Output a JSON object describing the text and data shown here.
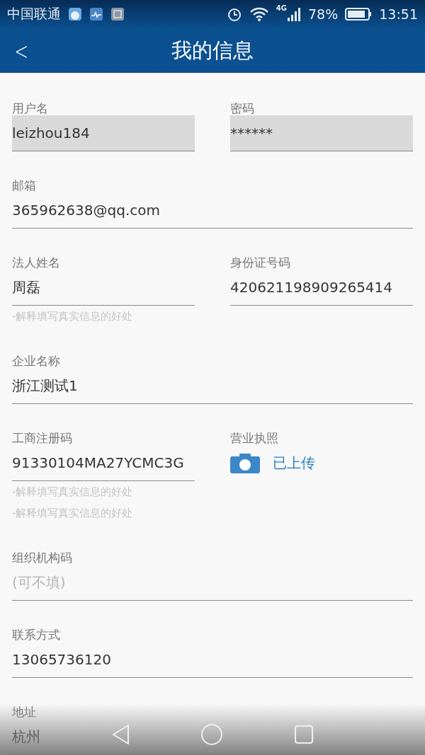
{
  "status_bar": {
    "carrier": "中国联通",
    "network": "4G",
    "battery": "78%",
    "time": "13:51"
  },
  "header": {
    "back": "<",
    "title": "我的信息"
  },
  "rows": [
    {
      "fields": [
        {
          "kind": "text",
          "label": "用户名",
          "value": "leizhou184",
          "disabled": true
        },
        {
          "kind": "text",
          "label": "密码",
          "value": "******",
          "disabled": true
        }
      ]
    },
    {
      "fields": [
        {
          "kind": "text",
          "label": "邮箱",
          "value": "365962638@qq.com",
          "disabled": false
        }
      ]
    },
    {
      "fields": [
        {
          "kind": "text",
          "label": "法人姓名",
          "value": "周磊",
          "disabled": false,
          "hints": [
            "-解释填写真实信息的好处"
          ]
        },
        {
          "kind": "text",
          "label": "身份证号码",
          "value": "420621198909265414",
          "disabled": false
        }
      ]
    },
    {
      "fields": [
        {
          "kind": "text",
          "label": "企业名称",
          "value": "浙江测试1",
          "disabled": false
        }
      ]
    },
    {
      "fields": [
        {
          "kind": "text",
          "label": "工商注册码",
          "value": "91330104MA27YCMC3G",
          "disabled": false,
          "hints": [
            "-解释填写真实信息的好处",
            "-解释填写真实信息的好处"
          ]
        },
        {
          "kind": "upload",
          "label": "营业执照",
          "status": "已上传"
        }
      ]
    },
    {
      "fields": [
        {
          "kind": "text",
          "label": "组织机构码",
          "placeholder": "(可不填)",
          "disabled": false
        }
      ]
    },
    {
      "fields": [
        {
          "kind": "text",
          "label": "联系方式",
          "value": "13065736120",
          "disabled": false
        }
      ]
    },
    {
      "fields": [
        {
          "kind": "text",
          "label": "地址",
          "value": "杭州",
          "disabled": false
        }
      ]
    }
  ]
}
